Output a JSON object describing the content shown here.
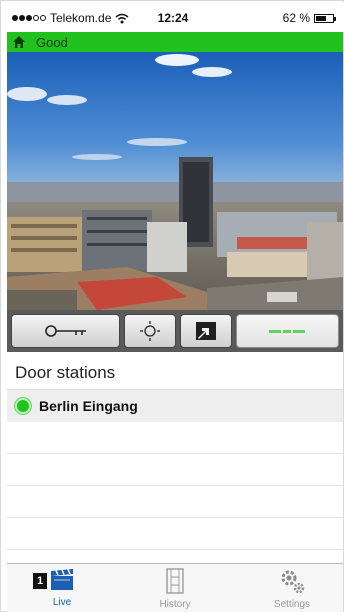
{
  "status_bar": {
    "carrier": "Telekom.de",
    "time": "12:24",
    "battery": "62 %",
    "battery_level": 0.62
  },
  "connection": {
    "status": "Good",
    "color": "#22c21e",
    "icon": "home-icon"
  },
  "controls": [
    {
      "name": "door-open-button",
      "icon": "key-icon"
    },
    {
      "name": "light-button",
      "icon": "light-bulb-icon"
    },
    {
      "name": "camera-switch-button",
      "icon": "camera-switch-icon"
    },
    {
      "name": "end-call-button",
      "icon": "hang-up-icon"
    }
  ],
  "door_stations": {
    "title": "Door stations",
    "items": [
      {
        "name": "Berlin Eingang",
        "status_color": "#21c41e"
      }
    ]
  },
  "tabs": [
    {
      "label": "Live",
      "icon": "clapperboard-icon",
      "active": true
    },
    {
      "label": "History",
      "icon": "film-strip-icon",
      "active": false
    },
    {
      "label": "Settings",
      "icon": "gears-icon",
      "active": false
    }
  ],
  "badge": "1",
  "colors": {
    "accent": "#1a5fb4",
    "inactive": "#9a9a9a"
  }
}
